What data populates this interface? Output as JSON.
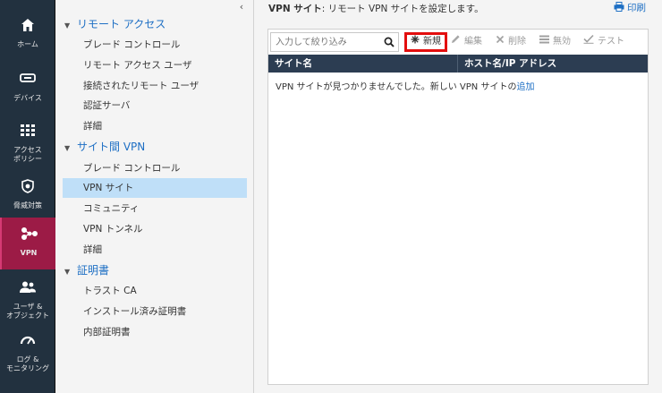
{
  "rail": {
    "items": [
      {
        "label": "ホーム",
        "icon": "home-icon"
      },
      {
        "label": "デバイス",
        "icon": "device-icon"
      },
      {
        "label": "アクセス\nポリシー",
        "icon": "access-policy-icon"
      },
      {
        "label": "脅威対策",
        "icon": "threat-prevention-icon"
      },
      {
        "label": "VPN",
        "icon": "vpn-icon",
        "active": true
      },
      {
        "label": "ユーザ &\nオブジェクト",
        "icon": "users-icon"
      },
      {
        "label": "ログ &\nモニタリング",
        "icon": "logs-icon"
      }
    ]
  },
  "nav": {
    "sections": [
      {
        "label": "リモート アクセス",
        "items": [
          "ブレード コントロール",
          "リモート アクセス ユーザ",
          "接続されたリモート ユーザ",
          "認証サーバ",
          "詳細"
        ]
      },
      {
        "label": "サイト間 VPN",
        "items": [
          "ブレード コントロール",
          "VPN サイト",
          "コミュニティ",
          "VPN トンネル",
          "詳細"
        ]
      },
      {
        "label": "証明書",
        "items": [
          "トラスト CA",
          "インストール済み証明書",
          "内部証明書"
        ]
      }
    ],
    "selected_item": "VPN サイト"
  },
  "header": {
    "title": "VPN サイト",
    "description": ": リモート VPN サイトを設定します。",
    "print_label": "印刷"
  },
  "toolbar": {
    "search_placeholder": "入力して絞り込み",
    "new_label": "新規",
    "edit_label": "編集",
    "delete_label": "削除",
    "disable_label": "無効",
    "test_label": "テスト"
  },
  "grid": {
    "columns": [
      "サイト名",
      "ホスト名/IP アドレス"
    ],
    "rows": [],
    "empty_message": "VPN サイトが見つかりませんでした。新しい VPN サイトの",
    "empty_link": "追加"
  },
  "colors": {
    "rail_bg": "#22313f",
    "rail_active": "#9c1b46",
    "link_blue": "#1e6fc4",
    "selected_bg": "#bfdff8",
    "grid_header": "#2c3d52",
    "highlight_red": "#e30e0e"
  }
}
